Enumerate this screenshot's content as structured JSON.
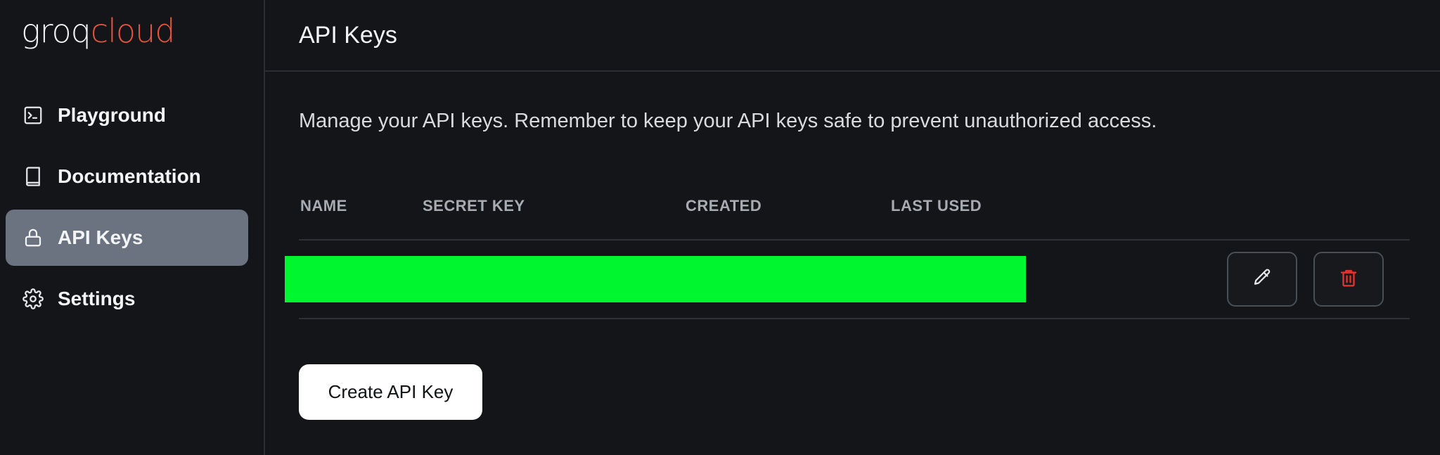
{
  "brand": {
    "part1": "groq",
    "part2": "cloud"
  },
  "sidebar": {
    "items": [
      {
        "label": "Playground",
        "icon": "terminal-icon",
        "active": false
      },
      {
        "label": "Documentation",
        "icon": "book-icon",
        "active": false
      },
      {
        "label": "API Keys",
        "icon": "lock-icon",
        "active": true
      },
      {
        "label": "Settings",
        "icon": "gear-icon",
        "active": false
      }
    ]
  },
  "header": {
    "title": "API Keys"
  },
  "main": {
    "description": "Manage your API keys. Remember to keep your API keys safe to prevent unauthorized access.",
    "table": {
      "columns": [
        "NAME",
        "SECRET KEY",
        "CREATED",
        "LAST USED"
      ]
    },
    "create_button": "Create API Key"
  },
  "colors": {
    "accent_red": "#E5533C",
    "active_nav": "#6B7280",
    "redaction": "#00F730",
    "delete_red": "#E5322D"
  }
}
